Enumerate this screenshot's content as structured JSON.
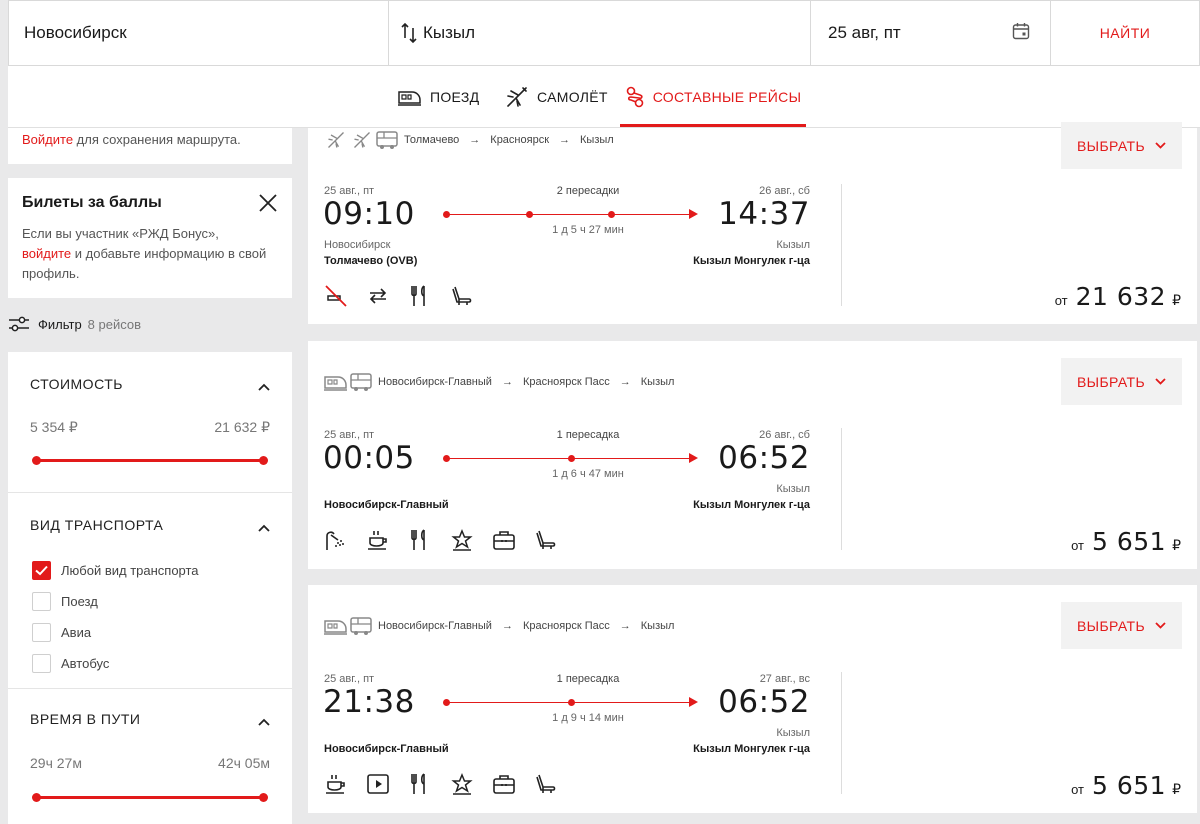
{
  "search": {
    "from": "Новосибирск",
    "to": "Кызыл",
    "date": "25 авг, пт",
    "find_label": "НАЙТИ"
  },
  "tabs": [
    {
      "label": "ПОЕЗД",
      "icon": "train-icon"
    },
    {
      "label": "САМОЛЁТ",
      "icon": "plane-icon"
    },
    {
      "label": "СОСТАВНЫЕ РЕЙСЫ",
      "icon": "route-icon",
      "active": true
    }
  ],
  "sidebar": {
    "login_link": "Войдите",
    "login_rest": " для сохранения маршрута.",
    "bonus": {
      "title": "Билеты за баллы",
      "text1": "Если вы участник «РЖД Бонус»,",
      "link": "войдите",
      "text2": " и добавьте информацию в свой профиль."
    },
    "filter_label": "Фильтр",
    "filter_count": "8 рейсов",
    "price": {
      "title": "СТОИМОСТЬ",
      "min": "5 354 ₽",
      "max": "21 632 ₽"
    },
    "transport": {
      "title": "ВИД ТРАНСПОРТА",
      "options": [
        {
          "label": "Любой вид транспорта",
          "checked": true
        },
        {
          "label": "Поезд",
          "checked": false
        },
        {
          "label": "Авиа",
          "checked": false
        },
        {
          "label": "Автобус",
          "checked": false
        }
      ]
    },
    "duration": {
      "title": "ВРЕМЯ В ПУТИ",
      "min": "29ч 27м",
      "max": "42ч 05м"
    }
  },
  "results": [
    {
      "route": [
        "Толмачево",
        "Красноярск",
        "Кызыл"
      ],
      "dep_date": "25 авг., пт",
      "dep_time": "09:10",
      "transfers": "2 пересадки",
      "duration": "1 д 5 ч 27 мин",
      "arr_date": "26 авг., сб",
      "arr_time": "14:37",
      "dep_city": "Новосибирск",
      "dep_station": "Толмачево (OVB)",
      "arr_city": "Кызыл",
      "arr_station": "Кызыл Монгулек г-ца",
      "price_prefix": "от",
      "price": "21 632",
      "currency": "₽",
      "select_label": "ВЫБРАТЬ"
    },
    {
      "route": [
        "Новосибирск-Главный",
        "Красноярск Пасс",
        "Кызыл"
      ],
      "dep_date": "25 авг., пт",
      "dep_time": "00:05",
      "transfers": "1 пересадка",
      "duration": "1 д 6 ч 47 мин",
      "arr_date": "26 авг., сб",
      "arr_time": "06:52",
      "dep_city": "",
      "dep_station": "Новосибирск-Главный",
      "arr_city": "Кызыл",
      "arr_station": "Кызыл Монгулек г-ца",
      "price_prefix": "от",
      "price": "5 651",
      "currency": "₽",
      "select_label": "ВЫБРАТЬ"
    },
    {
      "route": [
        "Новосибирск-Главный",
        "Красноярск Пасс",
        "Кызыл"
      ],
      "dep_date": "25 авг., пт",
      "dep_time": "21:38",
      "transfers": "1 пересадка",
      "duration": "1 д 9 ч 14 мин",
      "arr_date": "27 авг., вс",
      "arr_time": "06:52",
      "dep_city": "",
      "dep_station": "Новосибирск-Главный",
      "arr_city": "Кызыл",
      "arr_station": "Кызыл Монгулек г-ца",
      "price_prefix": "от",
      "price": "5 651",
      "currency": "₽",
      "select_label": "ВЫБРАТЬ"
    }
  ],
  "colors": {
    "accent": "#e21a1a",
    "background": "#e9e9ea"
  }
}
